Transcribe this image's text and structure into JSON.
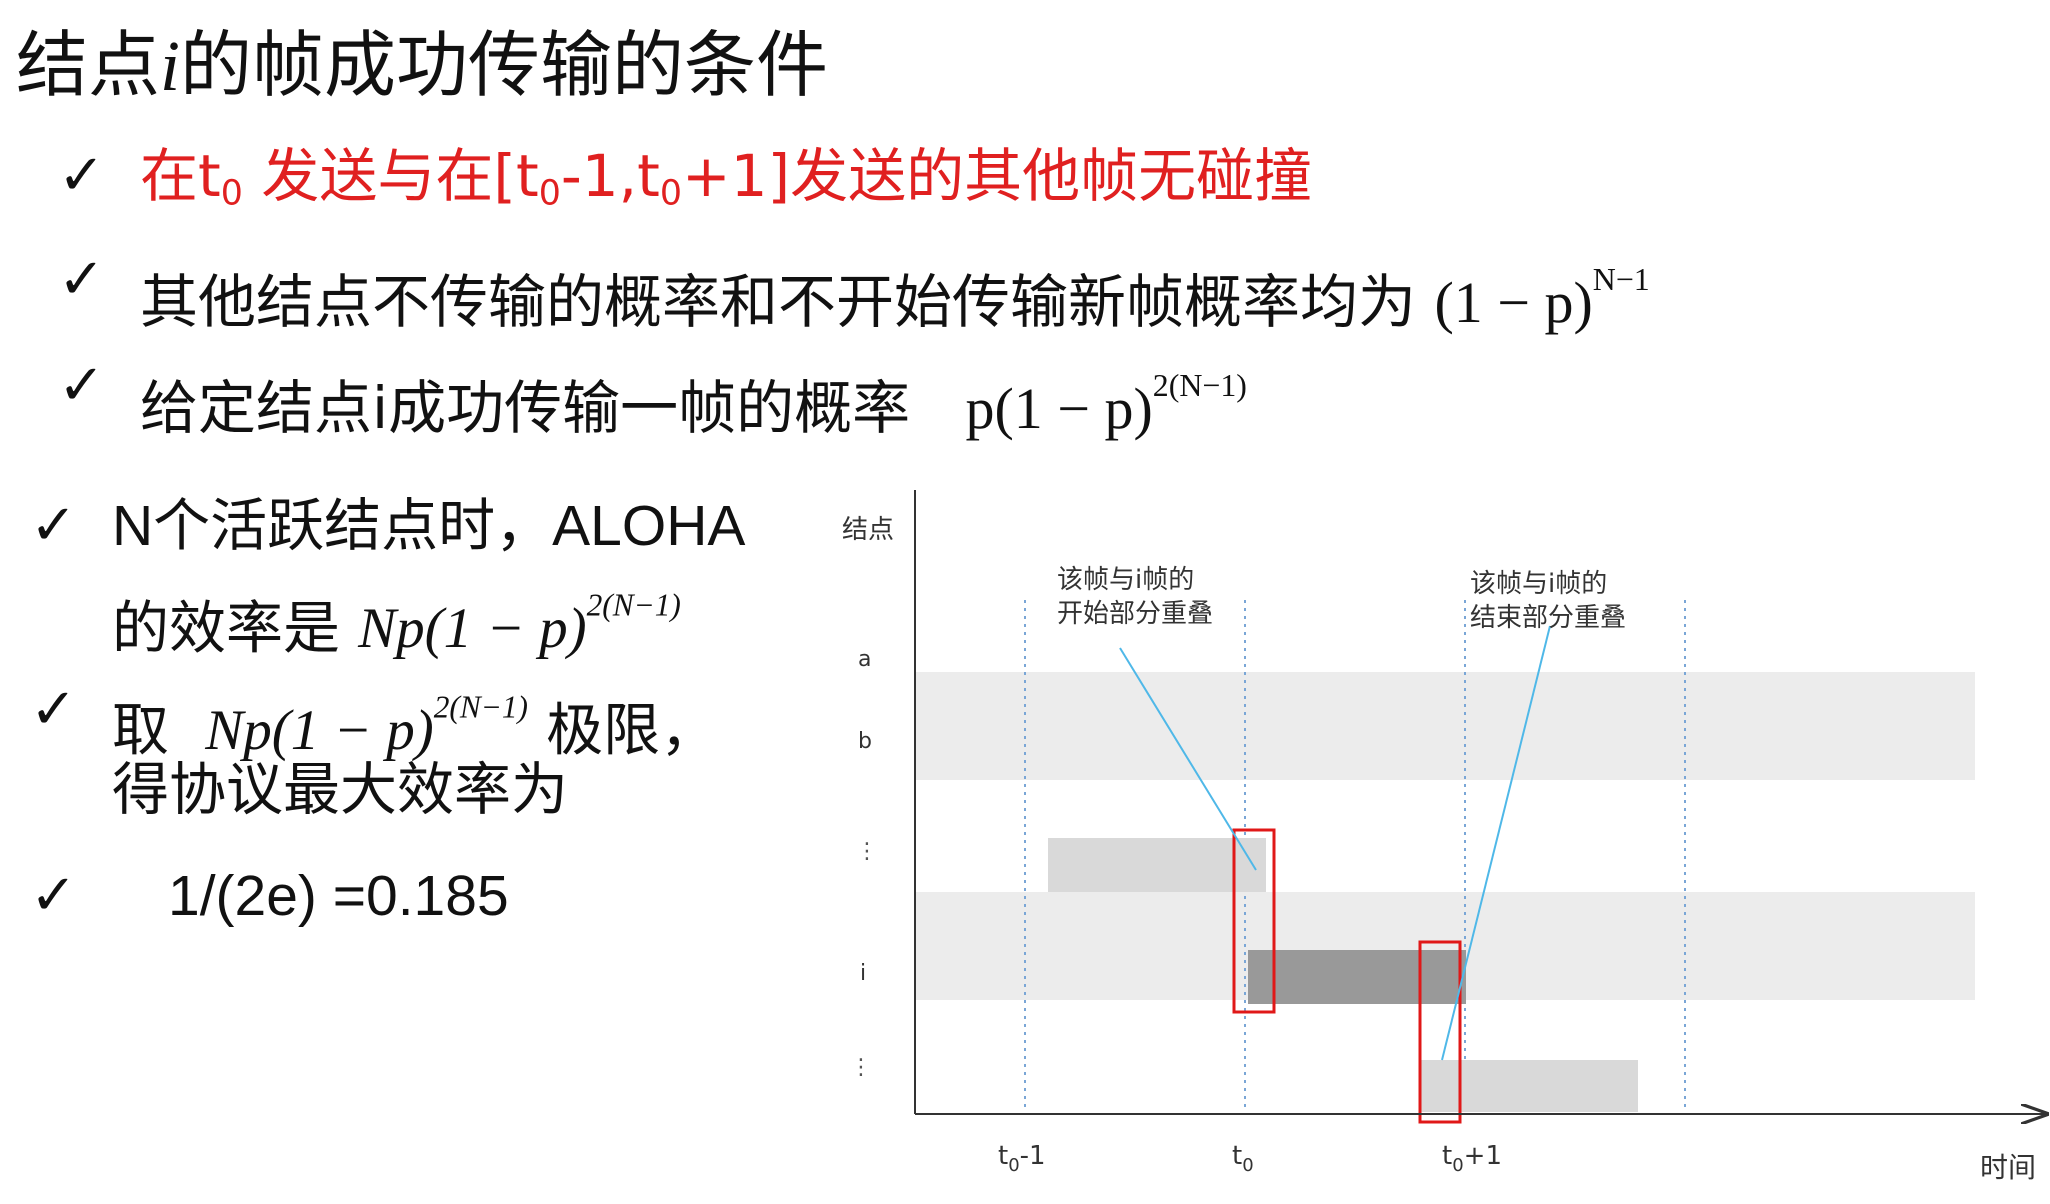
{
  "title": {
    "pre": "结点",
    "italic_i": "i",
    "post": "的帧成功传输的条件"
  },
  "top_bullets": {
    "b1": {
      "a": "在t",
      "sub1": "0",
      "b": " 发送与在[t",
      "sub2": "0",
      "c": "-1,t",
      "sub3": "0",
      "d": "+1]发送的其他帧无碰撞",
      "color": "#e02020"
    },
    "b2": {
      "text": "其他结点不传输的概率和不开始传输新帧概率均为",
      "formula_base": "(1 − p)",
      "formula_exp": "N−1"
    },
    "b3": {
      "text": "给定结点i成功传输一帧的概率",
      "formula_base": "p(1 − p)",
      "formula_exp": "2(N−1)"
    }
  },
  "left_bullets": {
    "l1": {
      "line1": "N个活跃结点时，ALOHA",
      "line2_text": "的效率是",
      "formula_base": "Np(1 − p)",
      "formula_exp": "2(N−1)"
    },
    "l2": {
      "pre": "取",
      "formula_base": "Np(1 − p)",
      "formula_exp": "2(N−1)",
      "post": "极限，",
      "line2": "得协议最大效率为"
    },
    "l3": {
      "text": "1/(2e) =0.185"
    }
  },
  "check_mark": "✓",
  "diagram": {
    "y_axis_label": "结点",
    "x_axis_label": "时间",
    "rows": [
      "a",
      "b",
      "⋮",
      "i",
      "⋮"
    ],
    "ticks": [
      {
        "base": "t",
        "sub": "0",
        "suffix": "-1"
      },
      {
        "base": "t",
        "sub": "0",
        "suffix": ""
      },
      {
        "base": "t",
        "sub": "0",
        "suffix": "+1"
      }
    ],
    "annotation_left": {
      "line1": "该帧与i帧的",
      "line2": "开始部分重叠"
    },
    "annotation_right": {
      "line1": "该帧与i帧的",
      "line2": "结束部分重叠"
    },
    "colors": {
      "band": "#ececec",
      "frame_light": "#d9d9d9",
      "frame_dark": "#999999",
      "highlight": "#e01818",
      "leader": "#4fb8e8",
      "guide": "#7aa6d6"
    }
  }
}
